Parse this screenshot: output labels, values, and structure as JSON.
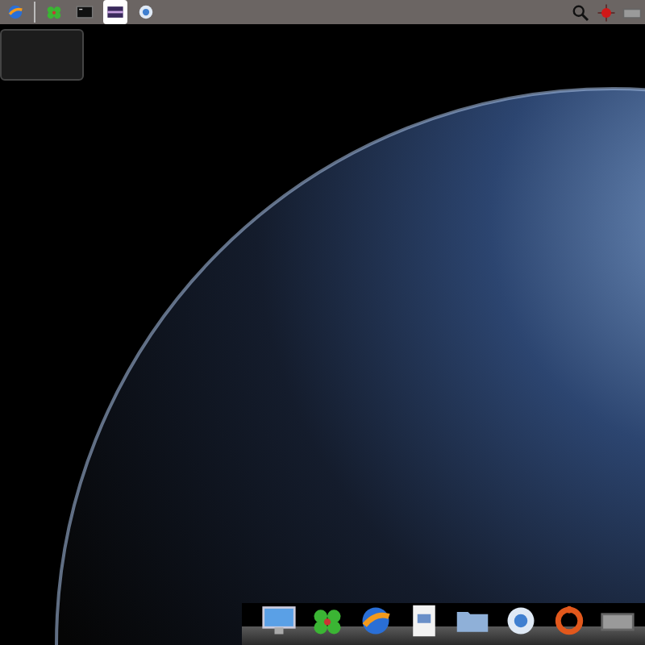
{
  "top_bar": {
    "launchers": [
      {
        "kind": "browser",
        "selected": false
      },
      {
        "kind": "clover",
        "selected": false
      },
      {
        "kind": "terminal",
        "selected": false
      },
      {
        "kind": "picture",
        "selected": true
      },
      {
        "kind": "music",
        "selected": false
      }
    ],
    "tray": [
      {
        "kind": "search"
      },
      {
        "kind": "target"
      },
      {
        "kind": "drive"
      }
    ]
  },
  "dock": {
    "items": [
      {
        "kind": "monitor"
      },
      {
        "kind": "clover"
      },
      {
        "kind": "browser"
      },
      {
        "kind": "document"
      },
      {
        "kind": "folder"
      },
      {
        "kind": "music"
      },
      {
        "kind": "ubuntu"
      },
      {
        "kind": "drive"
      }
    ]
  }
}
